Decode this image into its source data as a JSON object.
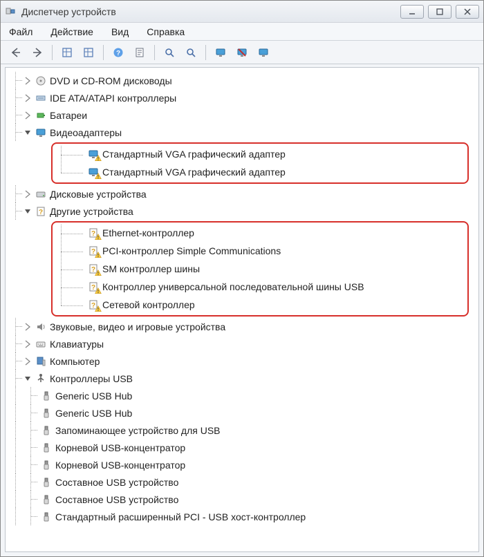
{
  "window": {
    "title": "Диспетчер устройств"
  },
  "menu": {
    "file": "Файл",
    "action": "Действие",
    "view": "Вид",
    "help": "Справка"
  },
  "tree": {
    "dvd": "DVD и CD-ROM дисководы",
    "ide": "IDE ATA/ATAPI контроллеры",
    "batteries": "Батареи",
    "video": "Видеоадаптеры",
    "video_child_1": "Стандартный VGA графический адаптер",
    "video_child_2": "Стандартный VGA графический адаптер",
    "disks": "Дисковые устройства",
    "other": "Другие устройства",
    "other_child_1": "Ethernet-контроллер",
    "other_child_2": "PCI-контроллер Simple Communications",
    "other_child_3": "SM контроллер шины",
    "other_child_4": "Контроллер универсальной последовательной шины USB",
    "other_child_5": "Сетевой контроллер",
    "sound": "Звуковые, видео и игровые устройства",
    "keyboards": "Клавиатуры",
    "computer": "Компьютер",
    "usb": "Контроллеры USB",
    "usb_child_1": "Generic USB Hub",
    "usb_child_2": "Generic USB Hub",
    "usb_child_3": "Запоминающее устройство для USB",
    "usb_child_4": "Корневой USB-концентратор",
    "usb_child_5": "Корневой USB-концентратор",
    "usb_child_6": "Составное USB устройство",
    "usb_child_7": "Составное USB устройство",
    "usb_child_8": "Стандартный расширенный PCI - USB хост-контроллер"
  }
}
